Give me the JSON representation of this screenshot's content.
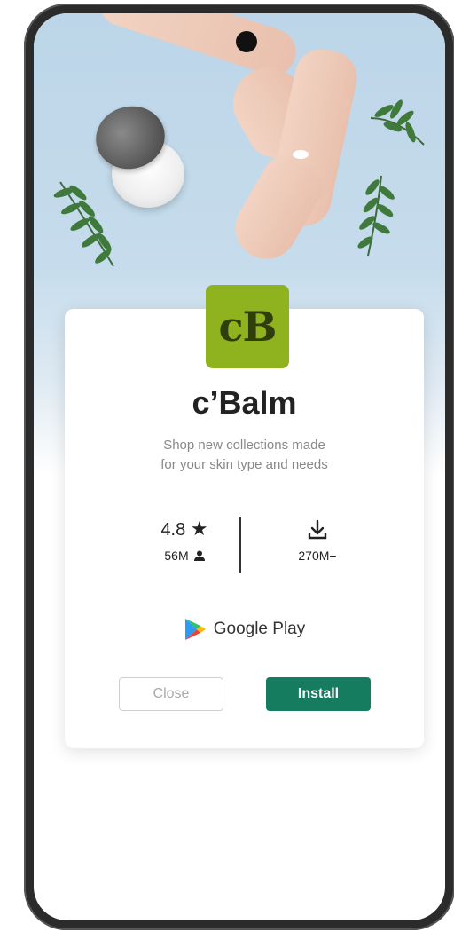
{
  "app": {
    "icon_text": "cB",
    "name": "c’Balm",
    "tagline_line1": "Shop new collections made",
    "tagline_line2": "for your skin type and needs"
  },
  "stats": {
    "rating": "4.8",
    "rating_icon": "star-icon",
    "reviews": "56M",
    "reviews_icon": "person-icon",
    "downloads_icon": "download-icon",
    "downloads": "270M+"
  },
  "store": {
    "label": "Google Play",
    "icon": "google-play-icon"
  },
  "buttons": {
    "close_label": "Close",
    "install_label": "Install"
  },
  "colors": {
    "accent": "#167c60",
    "icon_bg": "#8fb21f",
    "hero_bg": "#c6dcec"
  }
}
